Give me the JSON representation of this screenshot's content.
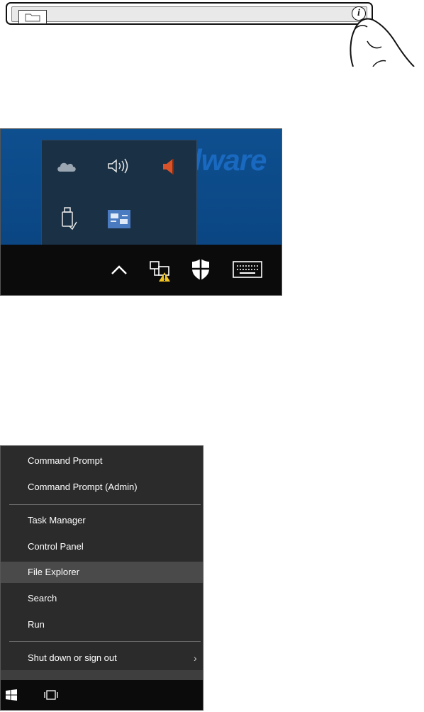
{
  "address_bar": {
    "folder_icon": "folder-icon",
    "info_icon": "info-icon",
    "info_glyph": "i",
    "pointer": "finger-icon"
  },
  "tray": {
    "wallpaper_text": "lware",
    "overflow_icons": [
      "onedrive-cloud-icon",
      "speaker-icon",
      "muted-speaker-icon",
      "usb-drive-icon",
      "network-adapter-icon"
    ],
    "taskbar_icons": [
      "show-hidden-icons-chevron",
      "network-warning-icon",
      "windows-defender-shield-icon",
      "touch-keyboard-icon"
    ],
    "colors": {
      "flyout": "#1a3045",
      "taskbar": "#0b0b0b",
      "desktop": "#0b4785"
    }
  },
  "menu": {
    "items": [
      {
        "label": "Command Prompt"
      },
      {
        "label": "Command Prompt (Admin)"
      },
      {
        "label": "Task Manager"
      },
      {
        "label": "Control Panel"
      },
      {
        "label": "File Explorer",
        "highlighted": true
      },
      {
        "label": "Search"
      },
      {
        "label": "Run"
      },
      {
        "label": "Shut down or sign out",
        "submenu": true
      }
    ],
    "submenu_arrow": "›",
    "taskbar_icons": [
      "windows-start-icon",
      "task-view-icon"
    ],
    "colors": {
      "background": "#2b2b2b",
      "highlight": "#4a4a4a",
      "text": "#ffffff"
    }
  }
}
